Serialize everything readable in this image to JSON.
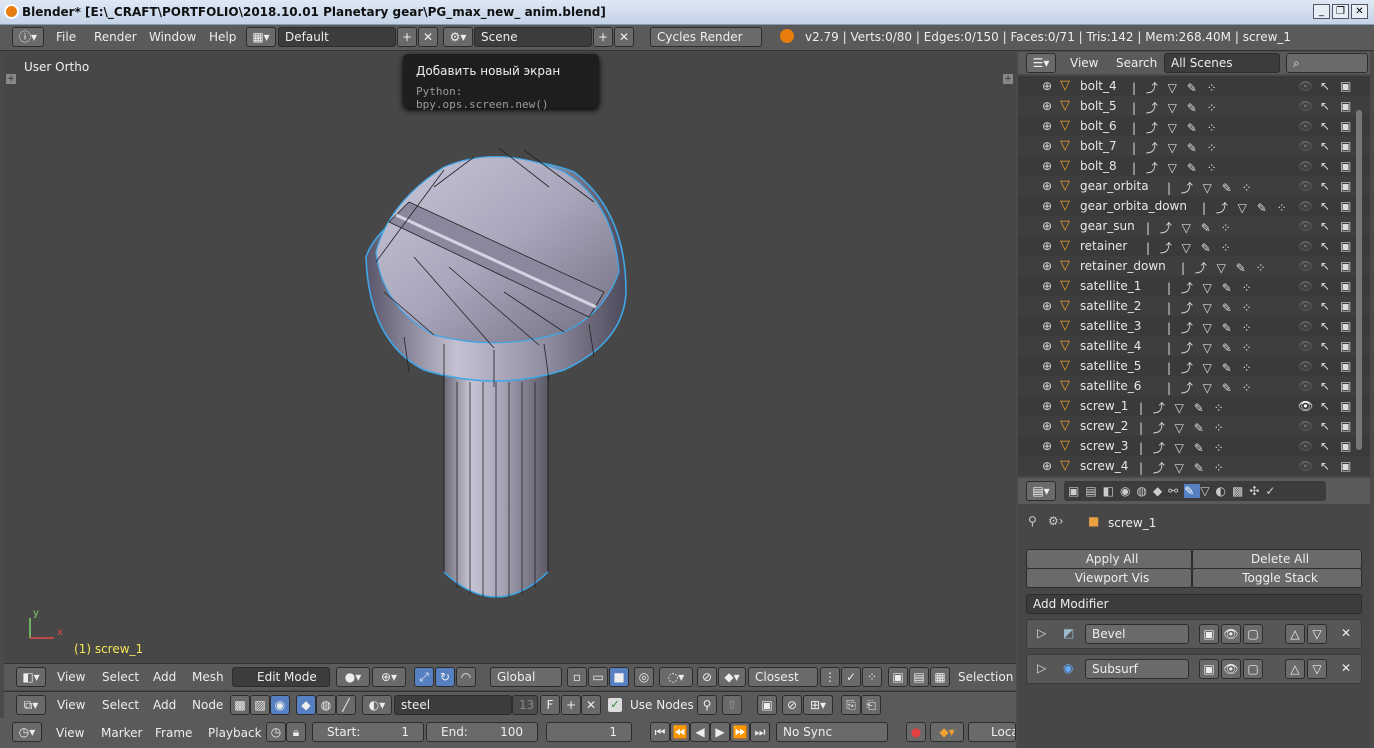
{
  "window": {
    "title": "Blender* [E:\\_CRAFT\\PORTFOLIO\\2018.10.01 Planetary gear\\PG_max_new_ anim.blend]",
    "buttons": [
      "_",
      "❐",
      "✕"
    ]
  },
  "topbar": {
    "menus": [
      "File",
      "Render",
      "Window",
      "Help"
    ],
    "screen_layout": "Default",
    "scene": "Scene",
    "render_engine": "Cycles Render",
    "stats": "v2.79 | Verts:0/80 | Edges:0/150 | Faces:0/71 | Tris:142 | Mem:268.40M | screw_1"
  },
  "tooltip": {
    "title": "Добавить новый экран",
    "python": "Python: bpy.ops.screen.new()"
  },
  "viewport": {
    "view_label": "User Ortho",
    "object_label": "(1) screw_1",
    "axis_y": "y",
    "axis_x": "x"
  },
  "view3d_header": {
    "menus": [
      "View",
      "Select",
      "Add",
      "Mesh"
    ],
    "mode": "Edit Mode",
    "orientation": "Global",
    "snap": "Closest",
    "selection": "Selection"
  },
  "node_header": {
    "menus": [
      "View",
      "Select",
      "Add",
      "Node"
    ],
    "material": "steel",
    "users": "13",
    "fake": "F",
    "use_nodes": "Use Nodes"
  },
  "timeline": {
    "menus": [
      "View",
      "Marker",
      "Frame",
      "Playback"
    ],
    "start_label": "Start:",
    "start": "1",
    "end_label": "End:",
    "end": "100",
    "current": "1",
    "sync": "No Sync",
    "keying": "Loca"
  },
  "outliner": {
    "menus": [
      "View",
      "Search"
    ],
    "filter": "All Scenes",
    "items": [
      "bolt_4",
      "bolt_5",
      "bolt_6",
      "bolt_7",
      "bolt_8",
      "gear_orbita",
      "gear_orbita_down",
      "gear_sun",
      "retainer",
      "retainer_down",
      "satellite_1",
      "satellite_2",
      "satellite_3",
      "satellite_4",
      "satellite_5",
      "satellite_6",
      "screw_1",
      "screw_2",
      "screw_3",
      "screw_4"
    ],
    "selected": "screw_1"
  },
  "properties": {
    "object": "screw_1",
    "apply_all": "Apply All",
    "delete_all": "Delete All",
    "viewport_vis": "Viewport Vis",
    "toggle_stack": "Toggle Stack",
    "add_modifier": "Add Modifier",
    "modifiers": [
      "Bevel",
      "Subsurf"
    ]
  },
  "colors": {
    "accent": "#5680c2",
    "wire": "#3fa7e8",
    "tooltip": "#1e1e1e"
  }
}
